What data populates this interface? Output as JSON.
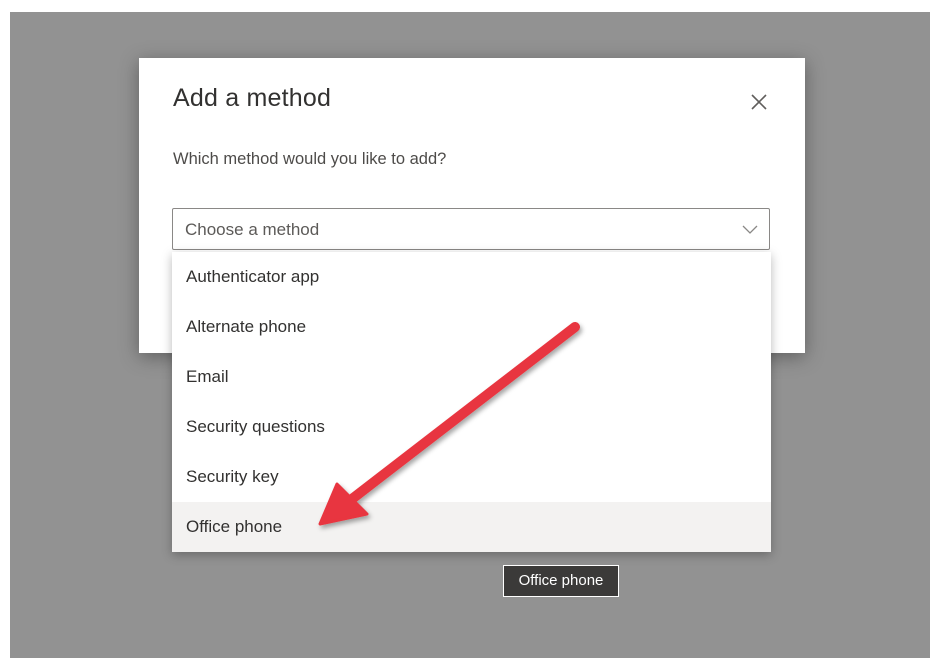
{
  "dialog": {
    "title": "Add a method",
    "prompt": "Which method would you like to add?",
    "close_icon": "close-icon"
  },
  "select": {
    "placeholder": "Choose a method",
    "chevron_icon": "chevron-down-icon"
  },
  "options": [
    "Authenticator app",
    "Alternate phone",
    "Email",
    "Security questions",
    "Security key",
    "Office phone"
  ],
  "hovered_option": "Office phone",
  "tooltip": "Office phone",
  "annotation": {
    "icon": "red-arrow-annotation",
    "color": "#e8363f"
  },
  "colors": {
    "overlay": "#929292",
    "hover": "#f3f2f1",
    "tooltip_bg": "#3b3a39"
  }
}
